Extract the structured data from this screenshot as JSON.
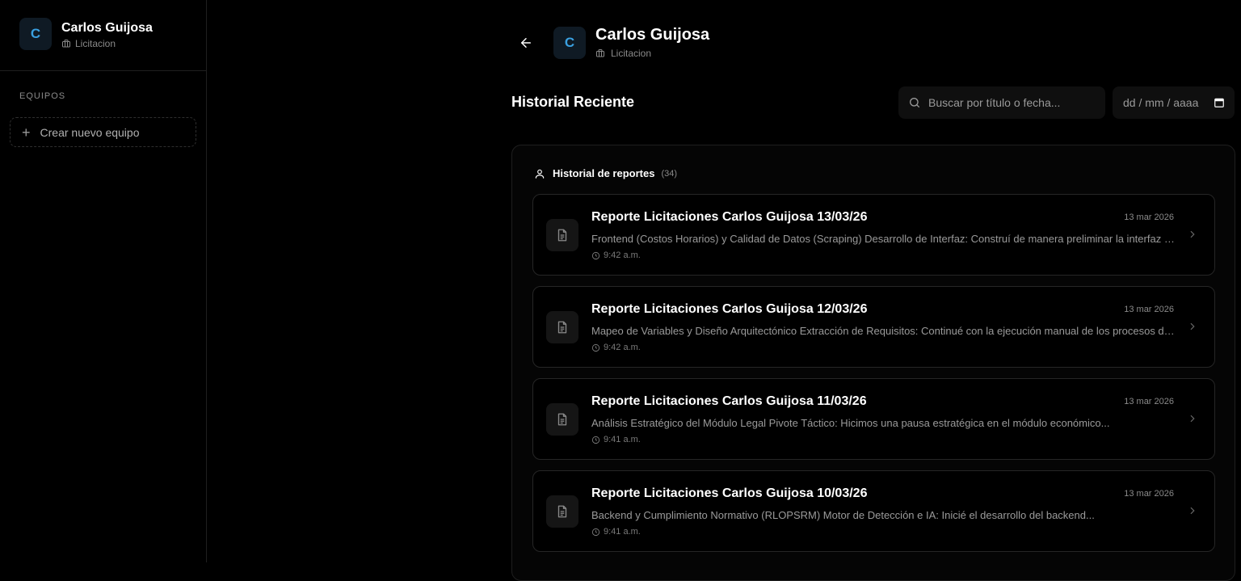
{
  "sidebar": {
    "user_initial": "C",
    "user_name": "Carlos Guijosa",
    "user_role": "Licitacion",
    "section_label": "EQUIPOS",
    "new_team_label": "Crear nuevo equipo"
  },
  "header": {
    "initial": "C",
    "name": "Carlos Guijosa",
    "role": "Licitacion"
  },
  "history": {
    "title": "Historial Reciente",
    "search_placeholder": "Buscar por título o fecha...",
    "date_placeholder": "dd / mm / aaaa"
  },
  "reports_panel": {
    "title": "Historial de reportes",
    "count": "(34)",
    "items": [
      {
        "title": "Reporte Licitaciones Carlos Guijosa 13/03/26",
        "date": "13 mar 2026",
        "description": "Frontend (Costos Horarios) y Calidad de Datos (Scraping) Desarrollo de Interfaz: Construí de manera preliminar la interfaz de costos horarios",
        "time": "9:42 a.m."
      },
      {
        "title": "Reporte Licitaciones Carlos Guijosa 12/03/26",
        "date": "13 mar 2026",
        "description": "Mapeo de Variables y Diseño Arquitectónico Extracción de Requisitos: Continué con la ejecución manual de los procesos de mapeo",
        "time": "9:42 a.m."
      },
      {
        "title": "Reporte Licitaciones Carlos Guijosa 11/03/26",
        "date": "13 mar 2026",
        "description": "Análisis Estratégico del Módulo Legal Pivote Táctico: Hicimos una pausa estratégica en el módulo económico...",
        "time": "9:41 a.m."
      },
      {
        "title": "Reporte Licitaciones Carlos Guijosa 10/03/26",
        "date": "13 mar 2026",
        "description": "Backend y Cumplimiento Normativo (RLOPSRM) Motor de Detección e IA: Inicié el desarrollo del backend...",
        "time": "9:41 a.m."
      }
    ]
  },
  "colors": {
    "background": "#000000",
    "avatar_bg": "#0f1a24",
    "avatar_fg": "#3aa0e0",
    "border": "#262626",
    "muted_text": "#8a8a8a"
  }
}
